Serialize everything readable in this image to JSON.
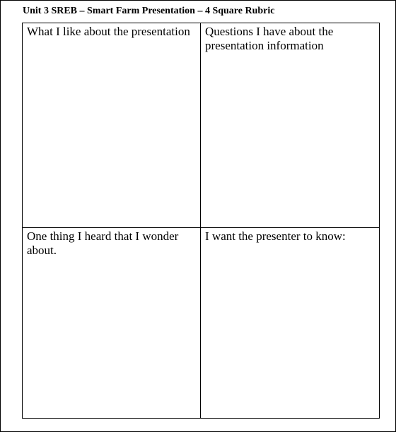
{
  "document": {
    "title": "Unit 3 SREB – Smart Farm Presentation – 4 Square Rubric"
  },
  "rubric": {
    "squares": [
      {
        "prompt": "What I like about the presentation"
      },
      {
        "prompt": "Questions I have about the presentation information"
      },
      {
        "prompt": "One thing I heard that I wonder about."
      },
      {
        "prompt": "I want the presenter to know:"
      }
    ]
  }
}
